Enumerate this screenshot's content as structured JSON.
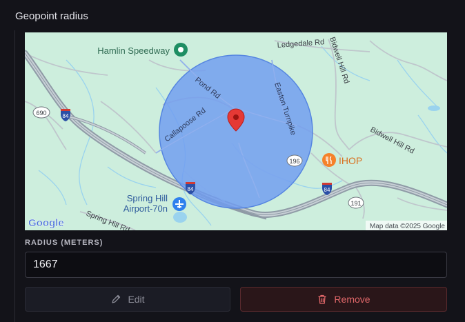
{
  "field": {
    "title": "Geopoint radius"
  },
  "map": {
    "labels": {
      "hamlin_speedway": "Hamlin Speedway",
      "ledgedale_rd": "Ledgedale Rd",
      "bidwell_hill_rd_top": "Bidwell Hill Rd",
      "bidwell_hill_rd_right": "Bidwell Hill Rd",
      "pond_rd": "Pond Rd",
      "easton_turnpike": "Easton Turnpike",
      "callapoose_rd": "Callapoose Rd",
      "route_690": "690",
      "route_84_left": "84",
      "route_84_mid": "84",
      "route_84_right": "84",
      "route_196": "196",
      "route_191": "191",
      "ihop": "IHOP",
      "spring_hill_airport_line1": "Spring Hill",
      "spring_hill_airport_line2": "Airport-70n",
      "spring_hill_rd": "Spring Hill Rd",
      "google_logo": "Google",
      "attribution": "Map data ©2025 Google"
    },
    "colors": {
      "land": "#cdeedd",
      "radius_fill": "#6f9cf0",
      "marker": "#e53935"
    }
  },
  "radius": {
    "label": "RADIUS (METERS)",
    "value": "1667"
  },
  "actions": {
    "edit_label": "Edit",
    "remove_label": "Remove"
  }
}
